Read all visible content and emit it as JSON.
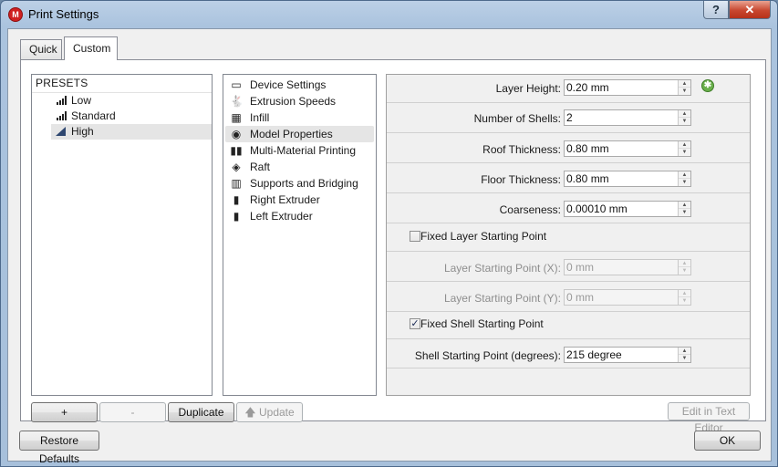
{
  "window": {
    "title": "Print Settings",
    "help_label": "?",
    "close_label": "✕",
    "app_icon_glyph": "M"
  },
  "tabs": [
    {
      "label": "Quick"
    },
    {
      "label": "Custom",
      "selected": true
    }
  ],
  "presets": {
    "header": "PRESETS",
    "items": [
      {
        "label": "Low",
        "icon": "signal-bars-icon"
      },
      {
        "label": "Standard",
        "icon": "signal-bars-icon"
      },
      {
        "label": "High",
        "icon": "triangle-icon",
        "selected": true
      }
    ]
  },
  "categories": [
    {
      "label": "Device Settings",
      "icon": "window-icon",
      "glyph": "▭"
    },
    {
      "label": "Extrusion Speeds",
      "icon": "rabbit-icon",
      "glyph": "🐇"
    },
    {
      "label": "Infill",
      "icon": "infill-grid-icon",
      "glyph": "▦"
    },
    {
      "label": "Model Properties",
      "icon": "model-target-icon",
      "glyph": "◉",
      "selected": true
    },
    {
      "label": "Multi-Material Printing",
      "icon": "dual-extruder-icon",
      "glyph": "▮▮"
    },
    {
      "label": "Raft",
      "icon": "layers-icon",
      "glyph": "◈"
    },
    {
      "label": "Supports and Bridging",
      "icon": "supports-icon",
      "glyph": "▥"
    },
    {
      "label": "Right Extruder",
      "icon": "extruder-icon",
      "glyph": "▮"
    },
    {
      "label": "Left Extruder",
      "icon": "extruder-icon",
      "glyph": "▮"
    }
  ],
  "properties": {
    "layer_height": {
      "label": "Layer Height:",
      "value": "0.20 mm"
    },
    "number_of_shells": {
      "label": "Number of Shells:",
      "value": "2"
    },
    "roof_thickness": {
      "label": "Roof Thickness:",
      "value": "0.80 mm"
    },
    "floor_thickness": {
      "label": "Floor Thickness:",
      "value": "0.80 mm"
    },
    "coarseness": {
      "label": "Coarseness:",
      "value": "0.00010 mm"
    },
    "fixed_layer_start": {
      "label": "Fixed Layer Starting Point",
      "checked": false
    },
    "layer_start_x": {
      "label": "Layer Starting Point (X):",
      "value": "0 mm",
      "disabled": true
    },
    "layer_start_y": {
      "label": "Layer Starting Point (Y):",
      "value": "0 mm",
      "disabled": true
    },
    "fixed_shell_start": {
      "label": "Fixed Shell Starting Point",
      "checked": true
    },
    "shell_start_point": {
      "label": "Shell Starting Point (degrees):",
      "value": "215 degree"
    }
  },
  "buttons": {
    "add": "+",
    "remove": "-",
    "duplicate": "Duplicate",
    "update": "Update",
    "update_arrow": "🡅",
    "edit_text": "Edit in Text Editor",
    "restore_defaults": "Restore Defaults",
    "ok": "OK"
  },
  "glyphs": {
    "spin_up": "▲",
    "spin_down": "▼",
    "check": "✓",
    "settings_badge": "✱"
  },
  "colors": {
    "accent_green": "#6ab04c",
    "selection_gray": "#e5e5e5",
    "close_red": "#c8472f"
  }
}
